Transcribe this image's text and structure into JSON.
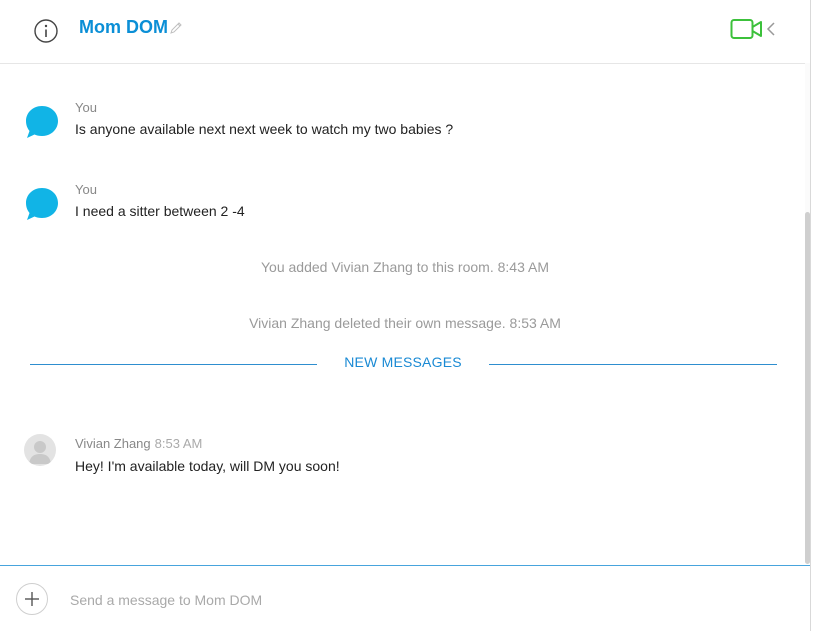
{
  "header": {
    "title": "Mom DOM",
    "icons": [
      "info-icon",
      "pencil-edit-icon",
      "video-camera-icon",
      "chevron-left-icon"
    ],
    "video_color": "#3cc13b",
    "title_color": "#0b8fd6"
  },
  "messages": [
    {
      "sender": "You",
      "text": "Is anyone available next next week to watch my two babies ?"
    },
    {
      "sender": "You",
      "text": "I need a sitter between 2 -4"
    }
  ],
  "system": [
    {
      "text": "You added Vivian Zhang to this room.",
      "time": "8:43 AM"
    },
    {
      "text": "Vivian Zhang deleted their own message.",
      "time": "8:53 AM"
    }
  ],
  "divider": {
    "label": "NEW MESSAGES"
  },
  "new_message": {
    "sender": "Vivian Zhang",
    "time": "8:53 AM",
    "text": "Hey! I'm available today, will DM you soon!"
  },
  "composer": {
    "placeholder": "Send a message to Mom DOM"
  }
}
